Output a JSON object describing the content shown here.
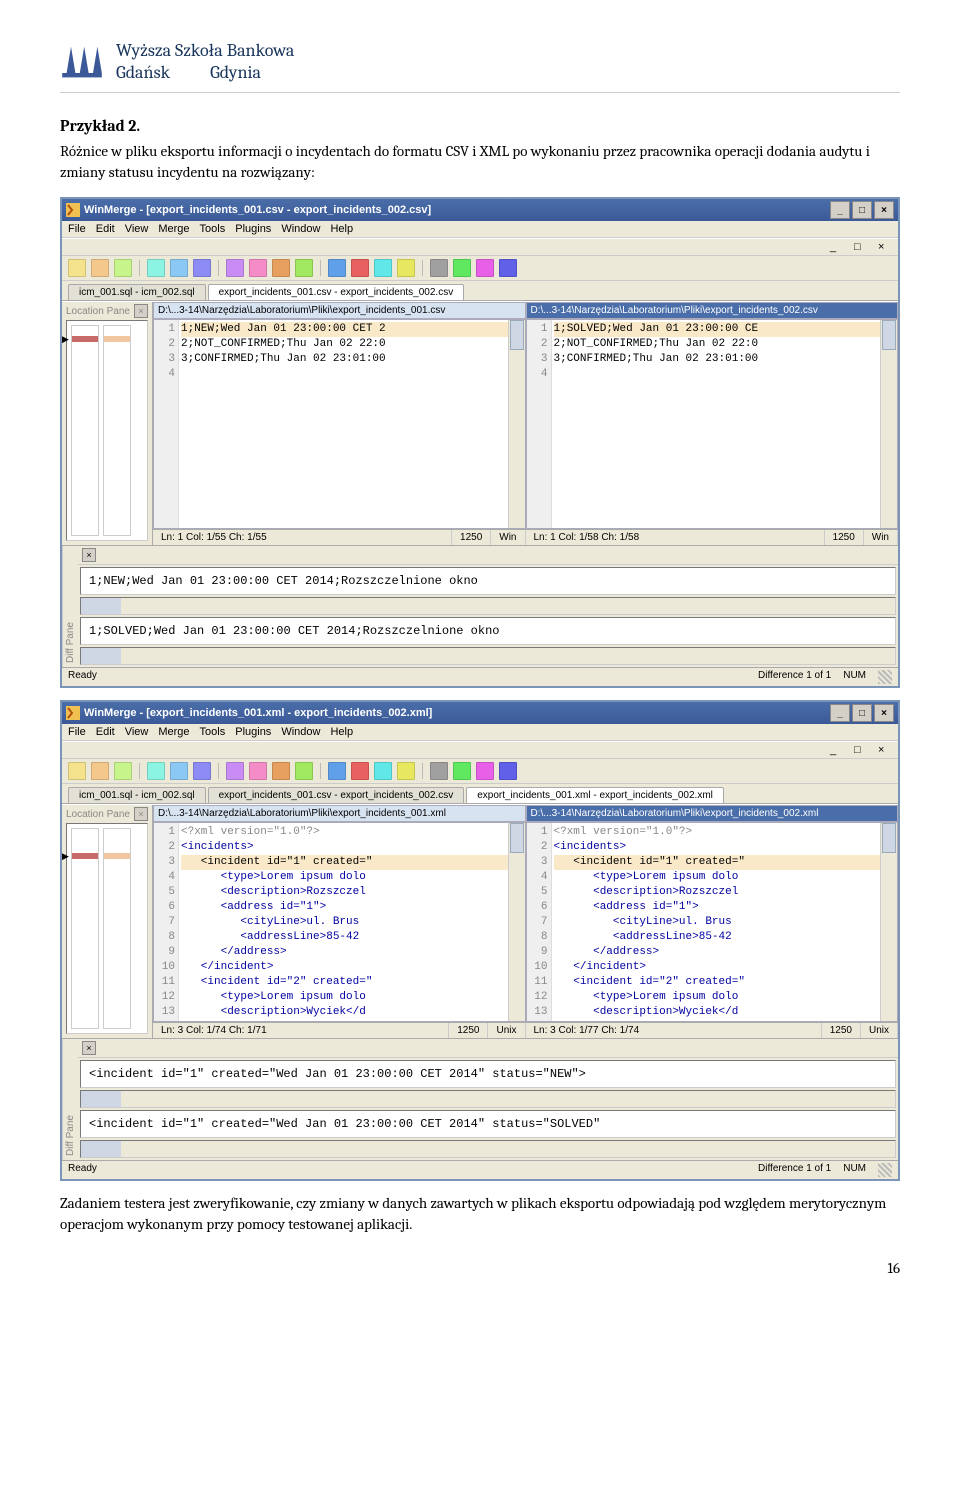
{
  "header": {
    "uni_line1": "Wyższa Szkoła Bankowa",
    "uni_line2a": "Gdańsk",
    "uni_line2b": "Gdynia"
  },
  "doc": {
    "example_heading": "Przykład 2.",
    "intro": "Różnice w pliku eksportu informacji o incydentach do formatu CSV i XML po wykonaniu przez pracownika operacji dodania audytu i zmiany statusu incydentu na rozwiązany:",
    "outro": "Zadaniem testera jest zweryfikowanie, czy zmiany w danych zawartych w plikach eksportu odpowiadają pod względem merytorycznym operacjom wykonanym przy pomocy testowanej aplikacji.",
    "page_number": "16"
  },
  "winA": {
    "title": "WinMerge - [export_incidents_001.csv - export_incidents_002.csv]",
    "menu": [
      "File",
      "Edit",
      "View",
      "Merge",
      "Tools",
      "Plugins",
      "Window",
      "Help"
    ],
    "tabs": [
      "icm_001.sql - icm_002.sql",
      "export_incidents_001.csv - export_incidents_002.csv"
    ],
    "activeTab": 1,
    "location_pane": "Location Pane",
    "diff_pane": "Diff Pane",
    "left": {
      "path": "D:\\...3-14\\Narzędzia\\Laboratorium\\Pliki\\export_incidents_001.csv",
      "gutter": [
        "1",
        "2",
        "3",
        "4"
      ],
      "lines": [
        "1;NEW;Wed Jan 01 23:00:00 CET 2",
        "2;NOT_CONFIRMED;Thu Jan 02 22:0",
        "3;CONFIRMED;Thu Jan 02 23:01:00",
        ""
      ],
      "diffIdx": [
        0
      ],
      "status": {
        "pos": "Ln: 1  Col: 1/55  Ch: 1/55",
        "cp": "1250",
        "eol": "Win"
      }
    },
    "right": {
      "path": "D:\\...3-14\\Narzędzia\\Laboratorium\\Pliki\\export_incidents_002.csv",
      "gutter": [
        "1",
        "2",
        "3",
        "4"
      ],
      "lines": [
        "1;SOLVED;Wed Jan 01 23:00:00 CE",
        "2;NOT_CONFIRMED;Thu Jan 02 22:0",
        "3;CONFIRMED;Thu Jan 02 23:01:00",
        ""
      ],
      "diffIdx": [
        0
      ],
      "status": {
        "pos": "Ln: 1  Col: 1/58  Ch: 1/58",
        "cp": "1250",
        "eol": "Win"
      }
    },
    "diff": {
      "top": "1;NEW;Wed Jan 01 23:00:00 CET 2014;Rozszczelnione okno",
      "top_hl": "NEW",
      "bottom": "1;SOLVED;Wed Jan 01 23:00:00 CET 2014;Rozszczelnione okno",
      "bottom_hl": "SOLVED"
    },
    "bottom": {
      "ready": "Ready",
      "diff": "Difference 1 of 1",
      "num": "NUM"
    }
  },
  "winB": {
    "title": "WinMerge - [export_incidents_001.xml - export_incidents_002.xml]",
    "menu": [
      "File",
      "Edit",
      "View",
      "Merge",
      "Tools",
      "Plugins",
      "Window",
      "Help"
    ],
    "tabs": [
      "icm_001.sql - icm_002.sql",
      "export_incidents_001.csv - export_incidents_002.csv",
      "export_incidents_001.xml - export_incidents_002.xml"
    ],
    "activeTab": 2,
    "location_pane": "Location Pane",
    "diff_pane": "Diff Pane",
    "left": {
      "path": "D:\\...3-14\\Narzędzia\\Laboratorium\\Pliki\\export_incidents_001.xml",
      "gutter": [
        "1",
        "2",
        "3",
        "4",
        "5",
        "6",
        "7",
        "8",
        "9",
        "10",
        "11",
        "12",
        "13"
      ],
      "lines": [
        "<?xml version=\"1.0\"?>",
        "<incidents>",
        "   <incident id=\"1\" created=\"",
        "      <type>Lorem ipsum dolo",
        "      <description>Rozszczel",
        "      <address id=\"1\">",
        "         <cityLine>ul. Brus",
        "         <addressLine>85-42",
        "      </address>",
        "   </incident>",
        "   <incident id=\"2\" created=\"",
        "      <type>Lorem ipsum dolo",
        "      <description>Wyciek</d"
      ],
      "diffIdx": [
        2
      ],
      "clsMap": [
        "xml-comment",
        "xml-tag",
        "",
        "xml-tag",
        "xml-tag",
        "xml-tag",
        "xml-tag",
        "xml-tag",
        "xml-tag",
        "xml-tag",
        "xml-tag",
        "xml-tag",
        "xml-tag"
      ],
      "status": {
        "pos": "Ln: 3  Col: 1/74  Ch: 1/71",
        "cp": "1250",
        "eol": "Unix"
      }
    },
    "right": {
      "path": "D:\\...3-14\\Narzędzia\\Laboratorium\\Pliki\\export_incidents_002.xml",
      "gutter": [
        "1",
        "2",
        "3",
        "4",
        "5",
        "6",
        "7",
        "8",
        "9",
        "10",
        "11",
        "12",
        "13"
      ],
      "lines": [
        "<?xml version=\"1.0\"?>",
        "<incidents>",
        "   <incident id=\"1\" created=\"",
        "      <type>Lorem ipsum dolo",
        "      <description>Rozszczel",
        "      <address id=\"1\">",
        "         <cityLine>ul. Brus",
        "         <addressLine>85-42",
        "      </address>",
        "   </incident>",
        "   <incident id=\"2\" created=\"",
        "      <type>Lorem ipsum dolo",
        "      <description>Wyciek</d"
      ],
      "diffIdx": [
        2
      ],
      "clsMap": [
        "xml-comment",
        "xml-tag",
        "",
        "xml-tag",
        "xml-tag",
        "xml-tag",
        "xml-tag",
        "xml-tag",
        "xml-tag",
        "xml-tag",
        "xml-tag",
        "xml-tag",
        "xml-tag"
      ],
      "status": {
        "pos": "Ln: 3  Col: 1/77  Ch: 1/74",
        "cp": "1250",
        "eol": "Unix"
      }
    },
    "diff": {
      "top": "<incident id=\"1\" created=\"Wed Jan 01 23:00:00 CET 2014\" status=\"NEW\">",
      "top_hl": "NEW",
      "bottom": "<incident id=\"1\" created=\"Wed Jan 01 23:00:00 CET 2014\" status=\"SOLVED\"",
      "bottom_hl": "SOLVED"
    },
    "bottom": {
      "ready": "Ready",
      "diff": "Difference 1 of 1",
      "num": "NUM"
    }
  },
  "toolbar_colors": [
    "#f4e28c",
    "#f4c88c",
    "#c8f48c",
    "#8cf4e2",
    "#8cc8f4",
    "#8c8cf4",
    "#c88cf4",
    "#f48cc8",
    "#e8a060",
    "#a0e860",
    "#60a0e8",
    "#e86060",
    "#60e8e8",
    "#e8e860",
    "#a0a0a0",
    "#60e860",
    "#e860e8",
    "#6060e8"
  ]
}
